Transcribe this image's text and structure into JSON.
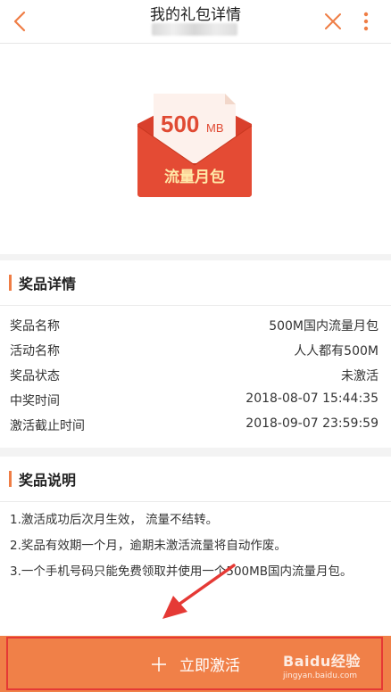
{
  "header": {
    "title": "我的礼包详情"
  },
  "hero": {
    "gift_amount": "500",
    "gift_unit": "MB",
    "gift_label": "流量月包"
  },
  "prize_details": {
    "title": "奖品详情",
    "rows": [
      {
        "label": "奖品名称",
        "value": "500M国内流量月包"
      },
      {
        "label": "活动名称",
        "value": "人人都有500M"
      },
      {
        "label": "奖品状态",
        "value": "未激活"
      },
      {
        "label": "中奖时间",
        "value": "2018-08-07 15:44:35"
      },
      {
        "label": "激活截止时间",
        "value": "2018-09-07 23:59:59"
      }
    ]
  },
  "prize_description": {
    "title": "奖品说明",
    "lines": [
      "1.激活成功后次月生效， 流量不结转。",
      "2.奖品有效期一个月，逾期未激活流量将自动作废。",
      "3.一个手机号码只能免费领取并使用一个500MB国内流量月包。"
    ]
  },
  "cta": {
    "label": "立即激活"
  },
  "watermark": {
    "brand": "Baidu经验",
    "url": "jingyan.baidu.com"
  },
  "colors": {
    "accent": "#f08048",
    "section_bar": "#ef7d45",
    "highlight_box": "#e53935",
    "envelope_red": "#e04a33"
  }
}
